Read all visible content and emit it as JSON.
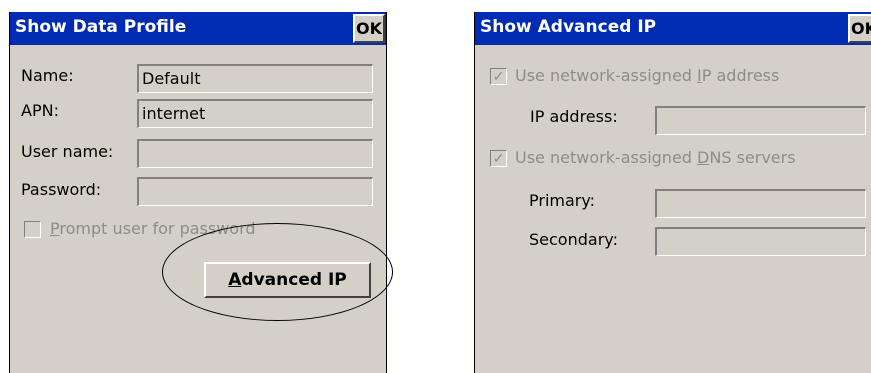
{
  "left": {
    "title": "Show Data Profile",
    "ok_label": "OK",
    "fields": [
      {
        "label": "Name:",
        "value": "Default"
      },
      {
        "label": "APN:",
        "value": "internet"
      },
      {
        "label": "User name:",
        "value": ""
      },
      {
        "label": "Password:",
        "value": ""
      }
    ],
    "prompt_checkbox": {
      "label_mnemonic": "P",
      "label_rest": "rompt user for password",
      "checked": false,
      "enabled": false
    },
    "advanced_button": {
      "mnemonic": "A",
      "rest": "dvanced IP"
    }
  },
  "right": {
    "title": "Show Advanced IP",
    "ok_label": "OK",
    "ip_checkbox": {
      "label_pre": "Use network-assigned ",
      "label_mnemonic": "I",
      "label_post": "P address",
      "checked": true,
      "enabled": false
    },
    "ip_address_label": "IP address:",
    "ip_address_value": "",
    "dns_checkbox": {
      "label_pre": "Use network-assigned ",
      "label_mnemonic": "D",
      "label_post": "NS servers",
      "checked": true,
      "enabled": false
    },
    "primary_label": "Primary:",
    "primary_value": "",
    "secondary_label": "Secondary:",
    "secondary_value": ""
  },
  "icons": {
    "checkmark": "✓"
  },
  "colors": {
    "titlebar": "#002cb4",
    "dialog_bg": "#d4d0c8",
    "disabled_text": "#8c8c8c"
  }
}
